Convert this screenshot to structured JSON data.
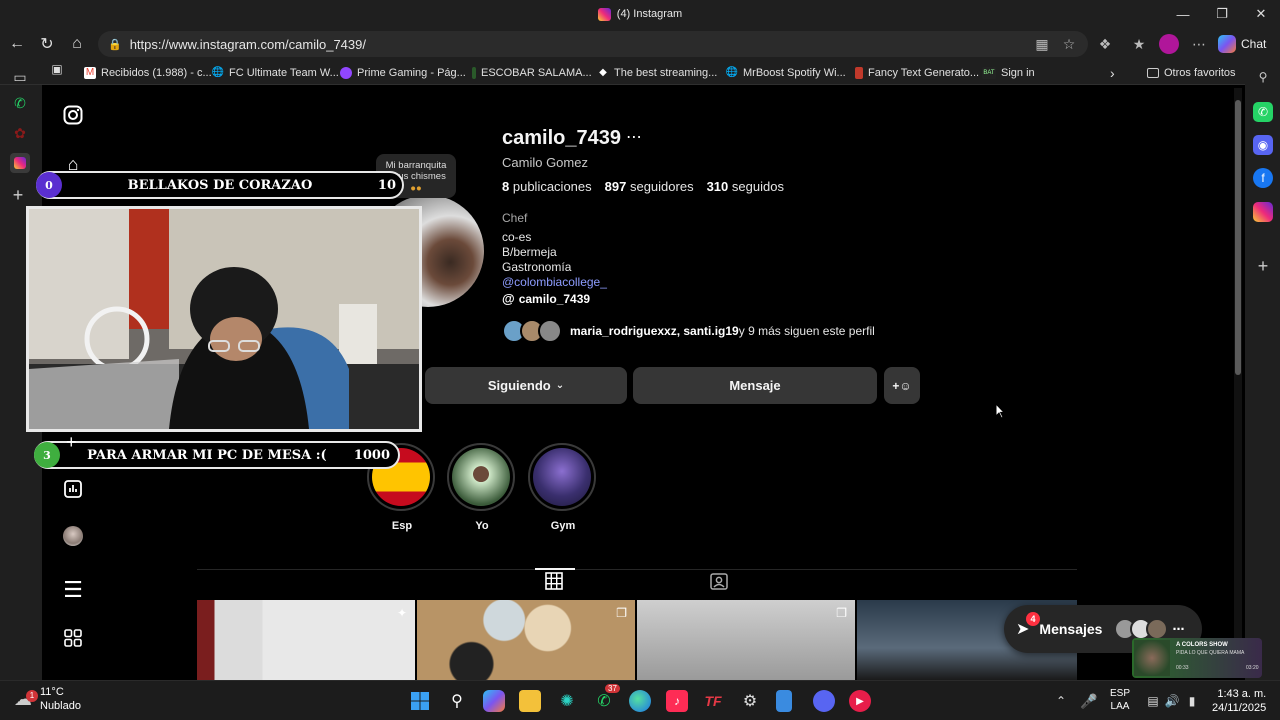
{
  "window": {
    "tab_title": "(4) Instagram"
  },
  "browser": {
    "url": "https://www.instagram.com/camilo_7439/",
    "chat_label": "Chat",
    "bookmarks": [
      {
        "label": "Recibidos (1.988) - c...",
        "icon": "gmail-icon"
      },
      {
        "label": "FC Ultimate Team W...",
        "icon": "globe-icon"
      },
      {
        "label": "Prime Gaming - Pág...",
        "icon": "prime-gaming-icon"
      },
      {
        "label": "ESCOBAR SALAMA...",
        "icon": "bookmark-icon"
      },
      {
        "label": "The best streaming...",
        "icon": "diamond-icon"
      },
      {
        "label": "MrBoost Spotify Wi...",
        "icon": "globe-icon"
      },
      {
        "label": "Fancy Text Generato...",
        "icon": "bookmark-icon"
      },
      {
        "label": "Sign in",
        "icon": "signin-icon"
      }
    ],
    "other_favorites": "Otros favoritos"
  },
  "profile": {
    "username": "camilo_7439",
    "full_name": "Camilo Gomez",
    "posts_count": "8",
    "posts_label": "publicaciones",
    "followers_count": "897",
    "followers_label": "seguidores",
    "following_count": "310",
    "following_label": "seguidos",
    "category": "Chef",
    "bio_lines": [
      "co-es",
      "B/bermeja",
      "Gastronomía"
    ],
    "bio_link": "@colombiacollege_",
    "threads_handle": "camilo_7439",
    "followed_by_names": "maria_rodriguexxz, santi.ig19",
    "followed_by_rest": " y 9 más siguen este perfil",
    "following_button": "Siguiendo",
    "message_button": "Mensaje"
  },
  "highlights": [
    {
      "label": "Esp",
      "color": "#c60b1e"
    },
    {
      "label": "Yo",
      "color": "#3b5b3a"
    },
    {
      "label": "Gym",
      "color": "#3a2f6e"
    }
  ],
  "messages_widget": {
    "label": "Mensajes",
    "badge": "4"
  },
  "tooltip": {
    "line1": "Mi barranquita",
    "line2": "y sus chismes"
  },
  "stream_overlay": {
    "top_bar": {
      "left_num": "0",
      "text": "BELLAKOS DE CORAZAO",
      "right_num": "10"
    },
    "bottom_bar": {
      "left_num": "3",
      "text": "PARA ARMAR MI PC DE MESA :(",
      "right_num": "1000"
    }
  },
  "mini_player": {
    "title": "A COLORS SHOW",
    "subtitle": "PIDA LO QUE QUIERA MAMA",
    "time_left": "00:33",
    "time_right": "03:20"
  },
  "taskbar": {
    "temperature": "11°C",
    "weather": "Nublado",
    "weather_badge": "1",
    "whatsapp_badge": "37",
    "lang_top": "ESP",
    "lang_bottom": "LAA",
    "time": "1:43 a. m.",
    "date": "24/11/2025"
  },
  "colors": {
    "accent_link": "#8e9dff",
    "button_bg": "#363636",
    "badge_red": "#ff3040"
  }
}
